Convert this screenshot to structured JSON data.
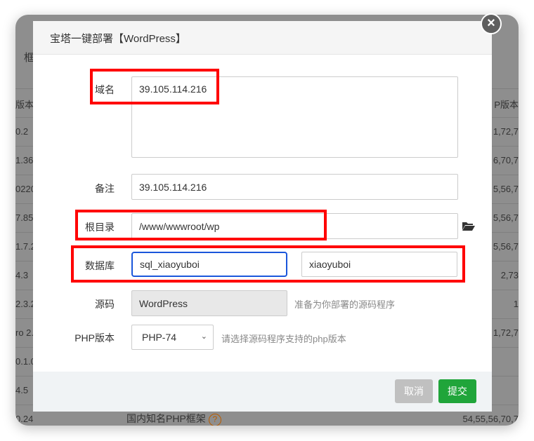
{
  "background": {
    "header_partial": "框",
    "rows": [
      {
        "left": "版本",
        "right": "P版本"
      },
      {
        "left": "0.2",
        "right": "1,72,7"
      },
      {
        "left": "1.36",
        "right": "6,70,7"
      },
      {
        "left": "0220",
        "right": "5,56,7"
      },
      {
        "left": "7.85",
        "right": "5,56,7"
      },
      {
        "left": "1.7.2",
        "right": "5,56,7"
      },
      {
        "left": "4.3",
        "right": "2,73"
      },
      {
        "left": "2.3.2",
        "right": "1"
      },
      {
        "left": "ro 2.0",
        "right": "1,72,7"
      },
      {
        "left": "0.1.0",
        "right": ""
      },
      {
        "left": "4.5",
        "right": ""
      },
      {
        "left": "0.24",
        "right": "54,55,56,70,7"
      }
    ],
    "footer_text": "国内知名PHP框架",
    "help_icon": "?"
  },
  "dialog": {
    "title": "宝塔一键部署【WordPress】",
    "close_icon": "×",
    "fields": {
      "domain": {
        "label": "域名",
        "value": "39.105.114.216"
      },
      "remark": {
        "label": "备注",
        "value": "39.105.114.216"
      },
      "root": {
        "label": "根目录",
        "value": "/www/wwwroot/wp"
      },
      "database": {
        "label": "数据库",
        "name": "sql_xiaoyuboi",
        "password": "xiaoyuboi"
      },
      "source": {
        "label": "源码",
        "value": "WordPress",
        "hint": "准备为你部署的源码程序"
      },
      "php": {
        "label": "PHP版本",
        "value": "PHP-74",
        "hint": "请选择源码程序支持的php版本"
      }
    },
    "buttons": {
      "cancel": "取消",
      "submit": "提交"
    }
  },
  "colors": {
    "submit": "#20a53a",
    "cancel": "#c0c0c0",
    "highlight": "#ff0000",
    "focus": "#1a56db"
  }
}
